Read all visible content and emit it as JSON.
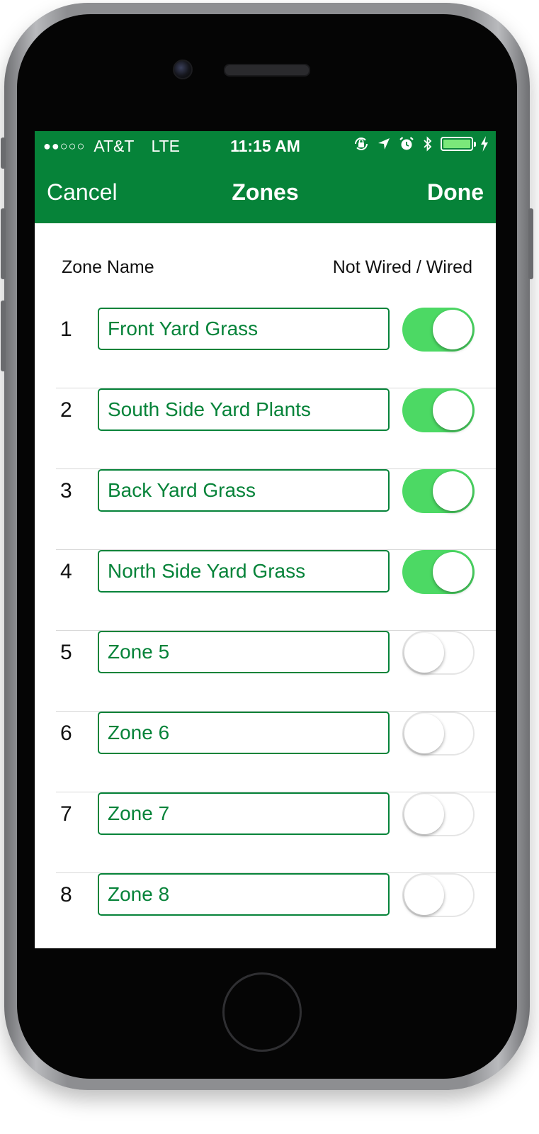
{
  "status_bar": {
    "signal": "●●○○○",
    "carrier": "AT&T",
    "network": "LTE",
    "time": "11:15 AM",
    "icons": [
      "orientation-lock-icon",
      "location-icon",
      "alarm-icon",
      "bluetooth-icon",
      "battery-icon",
      "charging-icon"
    ]
  },
  "nav": {
    "cancel_label": "Cancel",
    "title": "Zones",
    "done_label": "Done"
  },
  "columns": {
    "left": "Zone Name",
    "right": "Not Wired / Wired"
  },
  "colors": {
    "brand_green": "#068339",
    "toggle_on": "#4cd964"
  },
  "zones": [
    {
      "number": "1",
      "name": "Front Yard Grass",
      "wired": true
    },
    {
      "number": "2",
      "name": "South Side Yard Plants",
      "wired": true
    },
    {
      "number": "3",
      "name": "Back Yard Grass",
      "wired": true
    },
    {
      "number": "4",
      "name": "North Side Yard Grass",
      "wired": true
    },
    {
      "number": "5",
      "name": "Zone 5",
      "wired": false
    },
    {
      "number": "6",
      "name": "Zone 6",
      "wired": false
    },
    {
      "number": "7",
      "name": "Zone 7",
      "wired": false
    },
    {
      "number": "8",
      "name": "Zone 8",
      "wired": false
    }
  ]
}
